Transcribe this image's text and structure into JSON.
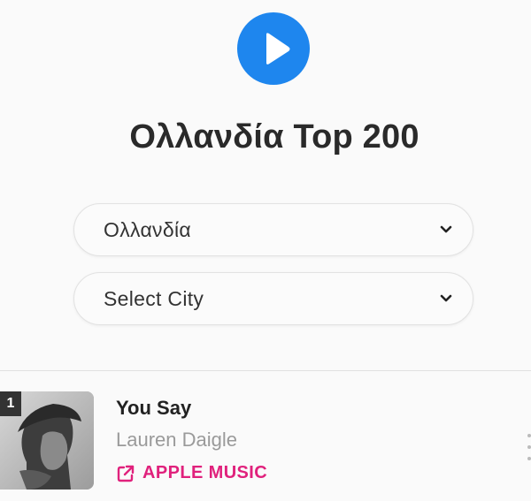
{
  "colors": {
    "brand": "#1e86ee",
    "apple_music": "#e0217c"
  },
  "header": {
    "logo_icon": "play-circle-icon",
    "title": "Ολλανδία Top 200"
  },
  "filters": {
    "country": {
      "selected": "Ολλανδία",
      "icon": "chevron-down-icon"
    },
    "city": {
      "selected": "Select City",
      "icon": "chevron-down-icon"
    }
  },
  "tracks": [
    {
      "rank": "1",
      "title": "You Say",
      "artist": "Lauren Daigle",
      "link_label": "APPLE MUSIC",
      "link_icon": "external-link-icon",
      "more_icon": "more-vertical-icon"
    }
  ]
}
